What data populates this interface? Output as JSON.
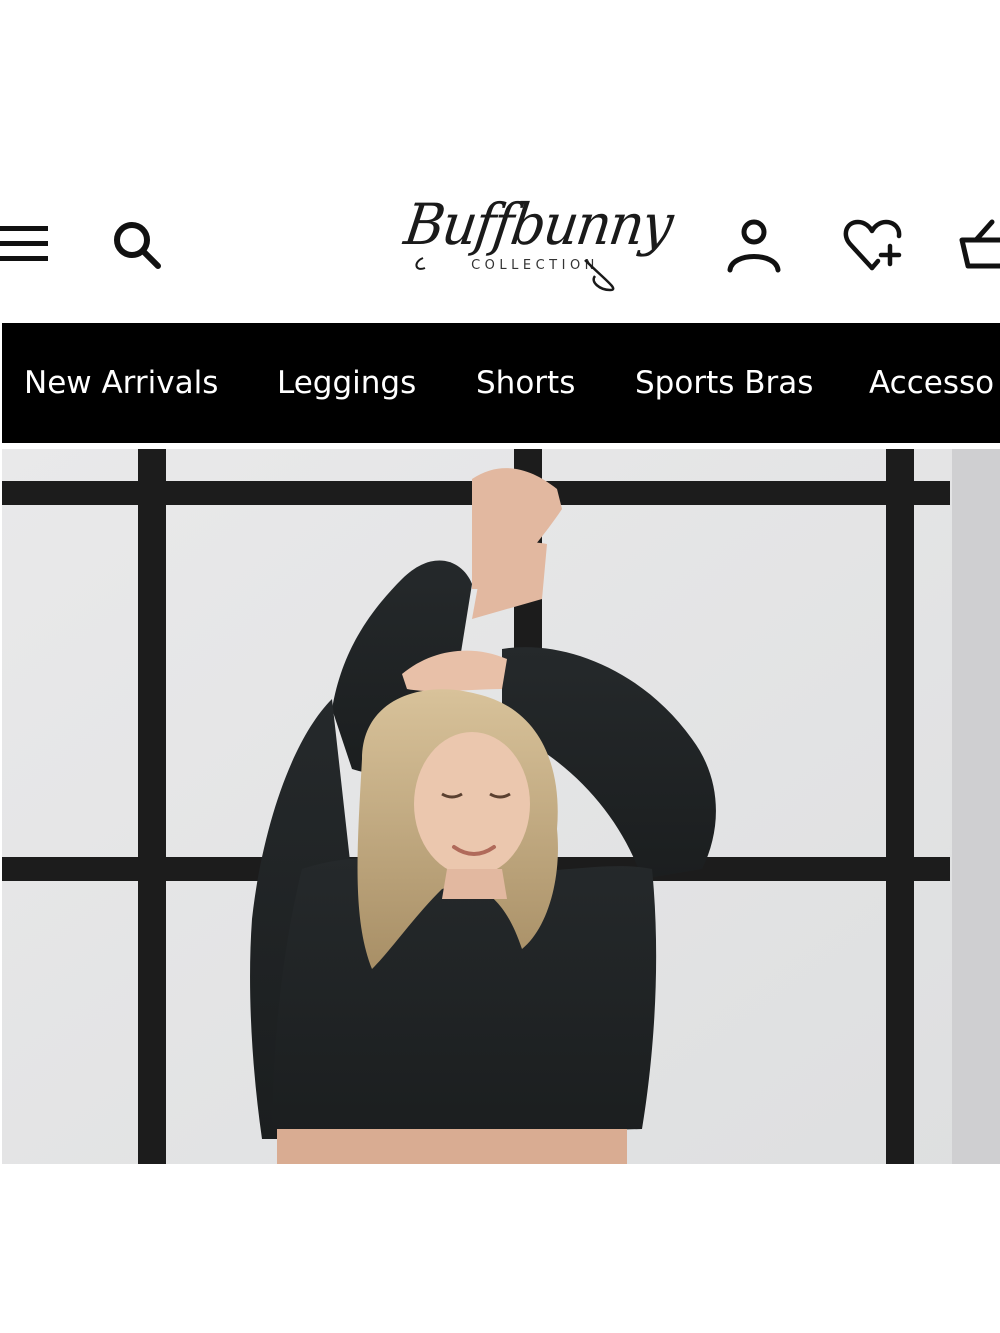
{
  "header": {
    "menu_icon": "hamburger-menu-icon",
    "search_icon": "search-icon",
    "logo": {
      "script_text": "Buffbunny",
      "sub_text": "COLLECTION"
    },
    "account_icon": "user-account-icon",
    "wishlist_icon": "heart-plus-icon",
    "cart_icon": "shopping-basket-icon"
  },
  "nav": {
    "items": [
      {
        "label": "New Arrivals"
      },
      {
        "label": "Leggings"
      },
      {
        "label": "Shorts"
      },
      {
        "label": "Sports Bras"
      },
      {
        "label": "Accesso"
      }
    ]
  },
  "hero": {
    "image_subject": "woman-in-black-cropped-sweatshirt-photo"
  },
  "colors": {
    "nav_background": "#000000",
    "nav_text": "#ffffff",
    "icon_color": "#111111",
    "page_background": "#ffffff"
  }
}
